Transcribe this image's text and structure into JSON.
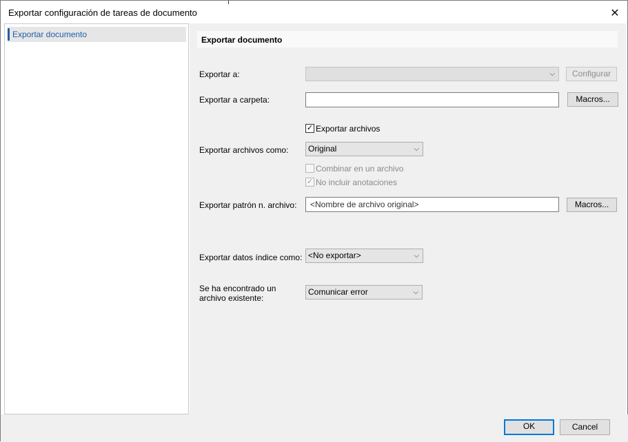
{
  "window": {
    "title": "Exportar configuración de tareas de documento",
    "close_icon": "✕"
  },
  "sidebar": {
    "items": [
      {
        "label": "Exportar documento",
        "selected": true
      }
    ]
  },
  "section": {
    "title": "Exportar documento"
  },
  "form": {
    "export_to": {
      "label": "Exportar a:",
      "value": "",
      "disabled": true,
      "configure_label": "Configurar"
    },
    "export_folder": {
      "label": "Exportar a carpeta:",
      "value": "",
      "macros_label": "Macros..."
    },
    "export_files": {
      "label": "Exportar archivos",
      "checked": true,
      "check_glyph": "✓"
    },
    "export_files_as": {
      "label": "Exportar archivos como:",
      "value": "Original"
    },
    "combine": {
      "label": "Combinar en un archivo",
      "checked": false,
      "disabled": true
    },
    "no_annotations": {
      "label": "No incluir anotaciones",
      "checked": true,
      "disabled": true,
      "check_glyph": "✓"
    },
    "filename_pattern": {
      "label": "Exportar patrón n. archivo:",
      "value": "<Nombre de archivo original>",
      "macros_label": "Macros..."
    },
    "index_data_as": {
      "label": "Exportar datos índice como:",
      "value": "<No exportar>"
    },
    "existing_file": {
      "label_line1": "Se ha encontrado un",
      "label_line2": "archivo existente:",
      "value": "Comunicar error"
    }
  },
  "footer": {
    "ok_label": "OK",
    "cancel_label": "Cancel"
  },
  "icons": {
    "chevron": "⌵"
  }
}
